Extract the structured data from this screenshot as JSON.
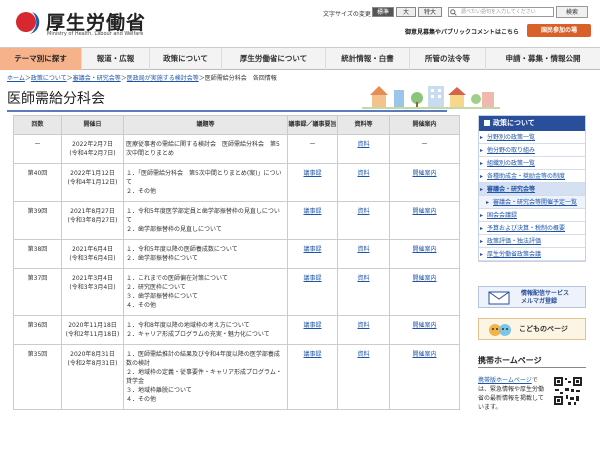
{
  "header": {
    "logo_main": "厚生労働省",
    "logo_sub": "Ministry of Health, Labour and Welfare",
    "font_size_label": "文字サイズの変更",
    "font_size_buttons": [
      "標準",
      "大",
      "特大"
    ],
    "search_placeholder": "調べたい語句を入力してください",
    "search_button": "検索",
    "links": "御意見募集やパブリックコメントはこちら",
    "gov_button": "国民参加の場"
  },
  "nav": [
    "テーマ別に探す",
    "報道・広報",
    "政策について",
    "厚生労働省について",
    "統計情報・白書",
    "所管の法令等",
    "申請・募集・情報公開"
  ],
  "breadcrumb": [
    "ホーム",
    "政策について",
    "審議会・研究会等",
    "医政局が実施する検討会等",
    "医師需給分科会　各回情報"
  ],
  "page_title": "医師需給分科会",
  "table": {
    "headers": [
      "回数",
      "開催日",
      "議題等",
      "議事録／議事要旨",
      "資料等",
      "開催案内"
    ],
    "rows": [
      {
        "num": "ー",
        "date": "2022年2月7日\n(令和4年2月7日)",
        "agenda": [
          "医療従事者の需給に関する検討会　医師需給分科会　第5次中間とりまとめ"
        ],
        "minutes": "ー",
        "materials": "資料",
        "notice": "ー"
      },
      {
        "num": "第40回",
        "date": "2022年1月12日\n(令和4年1月12日)",
        "agenda": [
          "１．「医師需給分科会　第5次中間とりまとめ(案)」について",
          "２．その他"
        ],
        "minutes": "議事録",
        "materials": "資料",
        "notice": "開催案内"
      },
      {
        "num": "第39回",
        "date": "2021年8月27日\n(令和3年8月27日)",
        "agenda": [
          "１．令和5年度医学部定員と歯学部振替枠の見直しについて",
          "２．歯学部振替枠の見直しについて"
        ],
        "minutes": "議事録",
        "materials": "資料",
        "notice": "開催案内"
      },
      {
        "num": "第38回",
        "date": "2021年6月4日\n(令和3年6月4日)",
        "agenda": [
          "１．令和5年度以降の医師養成数について",
          "２．歯学部振替枠について"
        ],
        "minutes": "議事録",
        "materials": "資料",
        "notice": "開催案内"
      },
      {
        "num": "第37回",
        "date": "2021年3月4日\n(令和3年3月4日)",
        "agenda": [
          "１．これまでの医師偏在対策について",
          "２．研究医枠について",
          "３．歯学部振替枠について",
          "４．その他"
        ],
        "minutes": "議事録",
        "materials": "資料",
        "notice": "開催案内"
      },
      {
        "num": "第36回",
        "date": "2020年11月18日\n(令和2年11月18日)",
        "agenda": [
          "１．令和8年度以降の地域枠の考え方について",
          "２．キャリア形成プログラムの充実・魅力化について"
        ],
        "minutes": "議事録",
        "materials": "資料",
        "notice": "開催案内"
      },
      {
        "num": "第35回",
        "date": "2020年8月31日\n(令和2年8月31日)",
        "agenda": [
          "１．医師需給推計の結果及び令和4年度以降の医学部養成数の検討",
          "２．地域枠の定義・従事要件・キャリア形成プログラム・貸学金",
          "３．地域枠離脱について",
          "４．その他"
        ],
        "minutes": "議事録",
        "materials": "資料",
        "notice": "開催案内"
      }
    ]
  },
  "sidebar": {
    "title": "政策について",
    "items": [
      {
        "label": "分野別の政策一覧",
        "sub": false,
        "active": false
      },
      {
        "label": "他分野の取り組み",
        "sub": false,
        "active": false
      },
      {
        "label": "組織別の政策一覧",
        "sub": false,
        "active": false
      },
      {
        "label": "各種助成金・奨励金等の制度",
        "sub": false,
        "active": false
      },
      {
        "label": "審議会・研究会等",
        "sub": false,
        "active": true
      },
      {
        "label": "審議会・研究会等開催予定一覧",
        "sub": true,
        "active": false
      },
      {
        "label": "国会会議録",
        "sub": false,
        "active": false
      },
      {
        "label": "予算および決算・税制の概要",
        "sub": false,
        "active": false
      },
      {
        "label": "政策評価・独法評価",
        "sub": false,
        "active": false
      },
      {
        "label": "厚生労働省政策会議",
        "sub": false,
        "active": false
      }
    ],
    "banner_mail": "情報配信サービス\nメルマガ登録",
    "banner_kids": "こどものページ",
    "mobile_title": "携帯ホームページ",
    "mobile_link": "携帯版ホームページ",
    "mobile_text": "では、緊急情報や厚生労働省の最新情報を掲載しています。"
  },
  "colors": {
    "accent_blue": "#2a4f9a",
    "nav_highlight": "#f6b28b",
    "orange_button": "#d8612a"
  }
}
